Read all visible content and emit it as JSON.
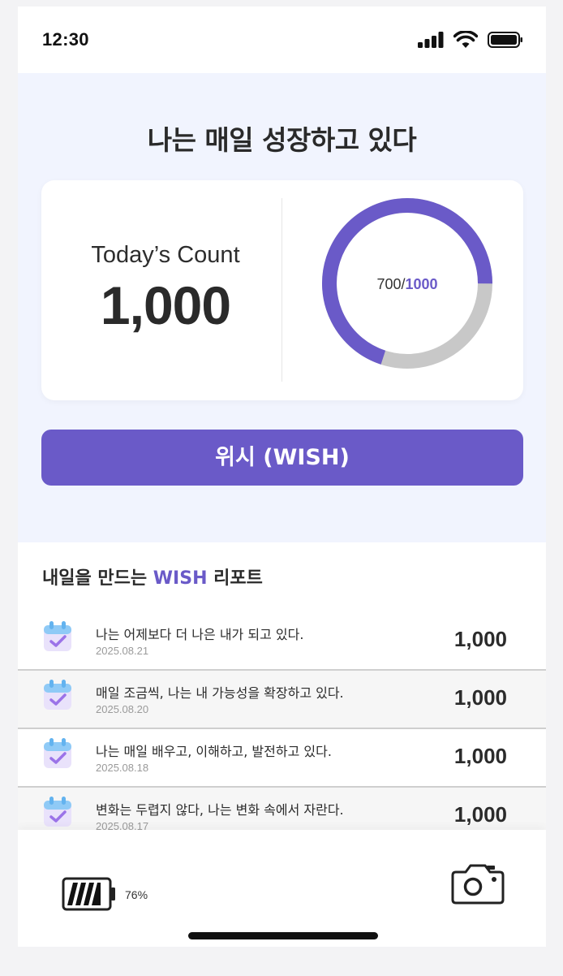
{
  "status": {
    "time": "12:30"
  },
  "hero": {
    "title": "나는 매일 성장하고 있다",
    "count_label": "Today’s Count",
    "count_value": "1,000",
    "progress": {
      "current": 700,
      "total": 1000,
      "current_text": "700/",
      "total_text": "1000"
    }
  },
  "wish_button": {
    "label": "위시 (WISH)"
  },
  "report": {
    "title_prefix": "내일을 만드는 ",
    "title_accent": "WISH",
    "title_suffix": " 리포트",
    "items": [
      {
        "text": "나는 어제보다 더 나은 내가 되고 있다.",
        "date": "2025.08.21",
        "count": "1,000"
      },
      {
        "text": "매일 조금씩, 나는 내 가능성을 확장하고 있다.",
        "date": "2025.08.20",
        "count": "1,000"
      },
      {
        "text": "나는 매일 배우고, 이해하고, 발전하고 있다.",
        "date": "2025.08.18",
        "count": "1,000"
      },
      {
        "text": "변화는 두렵지 않다, 나는 변화 속에서 자란다.",
        "date": "2025.08.17",
        "count": "1,000"
      }
    ]
  },
  "bottom": {
    "battery_percent": "76%",
    "battery_level": 0.76
  },
  "colors": {
    "accent": "#6a5ac8",
    "hero_bg": "#f1f4fe",
    "ring_track": "#c8c8c8"
  },
  "icons": [
    "signal-icon",
    "wifi-icon",
    "battery-icon",
    "calendar-check-icon",
    "camera-icon"
  ]
}
